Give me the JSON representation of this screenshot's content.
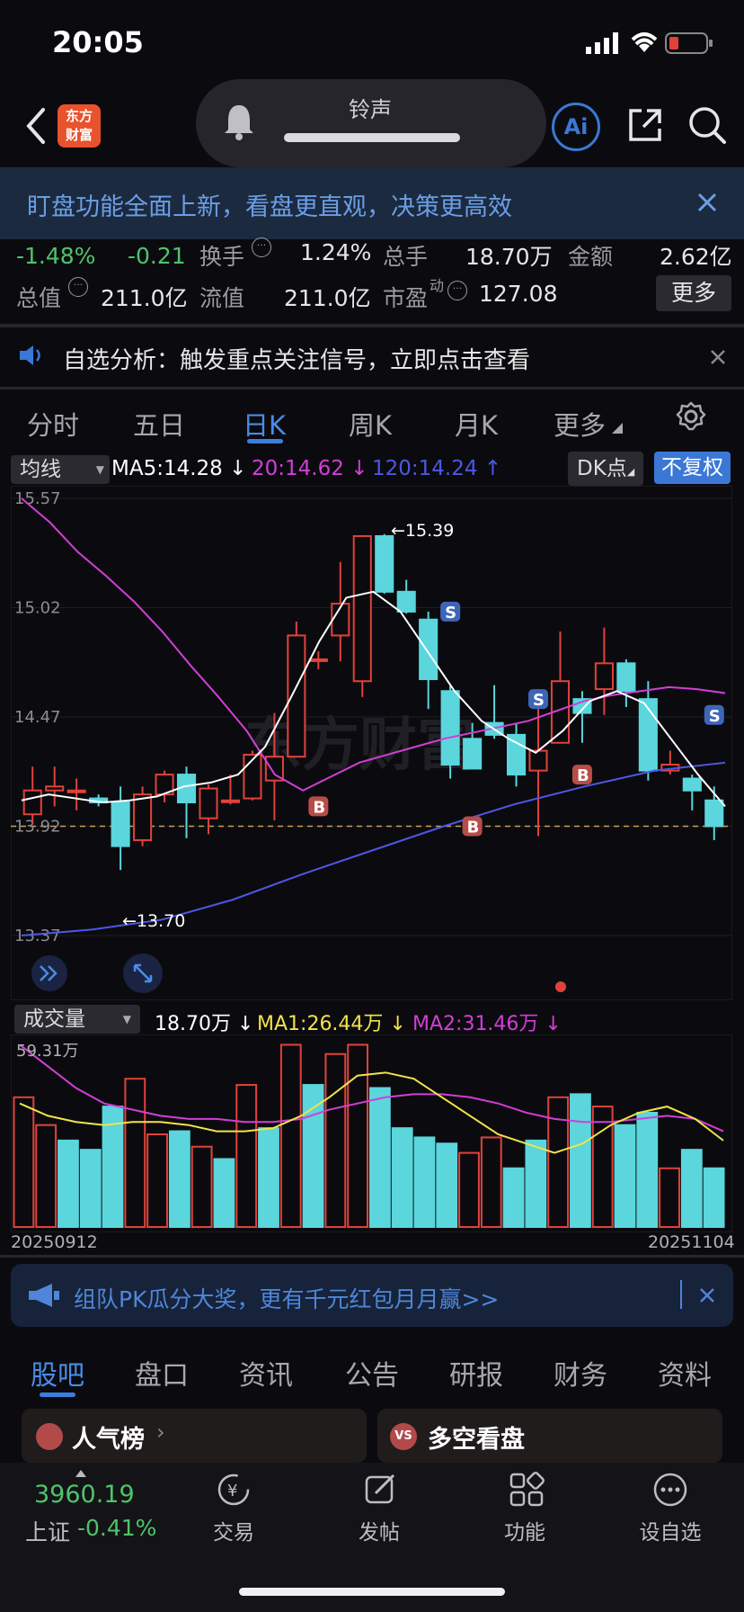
{
  "status": {
    "time": "20:05"
  },
  "header": {
    "logo": "东方\n财富",
    "logo_line1": "东方",
    "logo_line2": "财富",
    "pill_label": "铃声",
    "ai_label": "Ai"
  },
  "banner": {
    "text": "盯盘功能全面上新，看盘更直观，决策更高效"
  },
  "stats": {
    "change_pct": "-1.48%",
    "change_abs": "-0.21",
    "turnover_label": "换手",
    "turnover_value": "1.24%",
    "volume_label": "总手",
    "volume_value": "18.70万",
    "amount_label": "金额",
    "amount_value": "2.62亿",
    "mcap_label": "总值",
    "mcap_value": "211.0亿",
    "float_label": "流值",
    "float_value": "211.0亿",
    "pe_label": "市盈",
    "pe_sup": "动",
    "pe_value": "127.08",
    "more_button": "更多"
  },
  "notice": {
    "text": "自选分析：触发重点关注信号，立即点击查看"
  },
  "tabs": [
    {
      "label": "分时"
    },
    {
      "label": "五日"
    },
    {
      "label": "日K",
      "active": true
    },
    {
      "label": "周K"
    },
    {
      "label": "月K"
    },
    {
      "label": "更多"
    }
  ],
  "ma_bar": {
    "selector": "均线",
    "ma5": "MA5:14.28",
    "ma20": "20:14.62",
    "ma120": "120:14.24",
    "dk_button": "DK点",
    "fq_button": "不复权",
    "colors": {
      "ma5": "#ffffff",
      "ma20": "#d23ed6",
      "ma120": "#4c58e6",
      "up": "#e0423a",
      "down": "#5ad6dc"
    }
  },
  "chart_data": {
    "type": "candlestick",
    "y_ticks": [
      "15.57",
      "15.02",
      "14.47",
      "13.92",
      "13.37"
    ],
    "ylim": [
      13.37,
      15.57
    ],
    "price_line": 13.92,
    "annotations": {
      "high": "←15.39",
      "low": "←13.70"
    },
    "candles": [
      {
        "o": 13.98,
        "c": 14.1,
        "h": 14.22,
        "l": 13.93
      },
      {
        "o": 14.1,
        "c": 14.12,
        "h": 14.22,
        "l": 14.02
      },
      {
        "o": 14.1,
        "c": 14.1,
        "h": 14.16,
        "l": 14.0
      },
      {
        "o": 14.06,
        "c": 14.04,
        "h": 14.08,
        "l": 14.02
      },
      {
        "o": 14.04,
        "c": 13.82,
        "h": 14.12,
        "l": 13.7
      },
      {
        "o": 13.85,
        "c": 14.08,
        "h": 14.12,
        "l": 13.82
      },
      {
        "o": 14.08,
        "c": 14.18,
        "h": 14.2,
        "l": 14.04
      },
      {
        "o": 14.18,
        "c": 14.04,
        "h": 14.22,
        "l": 13.86
      },
      {
        "o": 13.96,
        "c": 14.11,
        "h": 14.13,
        "l": 13.88
      },
      {
        "o": 14.05,
        "c": 14.05,
        "h": 14.18,
        "l": 14.03
      },
      {
        "o": 14.06,
        "c": 14.28,
        "h": 14.3,
        "l": 14.05
      },
      {
        "o": 14.15,
        "c": 14.27,
        "h": 14.49,
        "l": 13.95
      },
      {
        "o": 14.27,
        "c": 14.88,
        "h": 14.95,
        "l": 14.27
      },
      {
        "o": 14.76,
        "c": 14.76,
        "h": 14.8,
        "l": 14.71
      },
      {
        "o": 14.88,
        "c": 15.04,
        "h": 15.25,
        "l": 14.75
      },
      {
        "o": 14.65,
        "c": 15.38,
        "h": 15.38,
        "l": 14.57
      },
      {
        "o": 15.38,
        "c": 15.1,
        "h": 15.39,
        "l": 15.09
      },
      {
        "o": 15.1,
        "c": 15.0,
        "h": 15.16,
        "l": 14.99
      },
      {
        "o": 14.96,
        "c": 14.66,
        "h": 15.0,
        "l": 14.51
      },
      {
        "o": 14.6,
        "c": 14.23,
        "h": 14.63,
        "l": 14.16
      },
      {
        "o": 14.36,
        "c": 14.21,
        "h": 14.44,
        "l": 14.22
      },
      {
        "o": 14.44,
        "c": 14.38,
        "h": 14.63,
        "l": 14.36
      },
      {
        "o": 14.38,
        "c": 14.18,
        "h": 14.44,
        "l": 14.12
      },
      {
        "o": 14.2,
        "c": 14.3,
        "h": 14.61,
        "l": 13.87
      },
      {
        "o": 14.34,
        "c": 14.65,
        "h": 14.9,
        "l": 14.35
      },
      {
        "o": 14.56,
        "c": 14.49,
        "h": 14.6,
        "l": 14.34
      },
      {
        "o": 14.61,
        "c": 14.74,
        "h": 14.92,
        "l": 14.48
      },
      {
        "o": 14.74,
        "c": 14.6,
        "h": 14.76,
        "l": 14.52
      },
      {
        "o": 14.56,
        "c": 14.2,
        "h": 14.65,
        "l": 14.15
      },
      {
        "o": 14.2,
        "c": 14.23,
        "h": 14.3,
        "l": 14.18
      },
      {
        "o": 14.16,
        "c": 14.1,
        "h": 14.18,
        "l": 14.0
      },
      {
        "o": 14.05,
        "c": 13.92,
        "h": 14.12,
        "l": 13.85
      }
    ],
    "ma5": [
      14.05,
      14.08,
      14.06,
      14.04,
      14.05,
      14.07,
      14.12,
      14.14,
      14.18,
      14.32,
      14.58,
      14.85,
      15.07,
      15.1,
      15.0,
      14.8,
      14.6,
      14.45,
      14.36,
      14.29,
      14.4,
      14.55,
      14.6,
      14.54,
      14.36,
      14.18,
      14.02
    ],
    "ma20": [
      15.57,
      15.45,
      15.3,
      15.18,
      15.05,
      14.9,
      14.73,
      14.57,
      14.4,
      14.18,
      14.1,
      14.17,
      14.24,
      14.28,
      14.32,
      14.36,
      14.39,
      14.42,
      14.45,
      14.5,
      14.55,
      14.58,
      14.6,
      14.62,
      14.61,
      14.59
    ],
    "ma120": [
      13.37,
      13.4,
      13.45,
      13.55,
      13.68,
      13.8,
      13.92,
      14.03,
      14.12,
      14.2,
      14.24
    ],
    "signals": [
      {
        "label": "B",
        "kind": "buy"
      },
      {
        "label": "B",
        "kind": "buy"
      },
      {
        "label": "B",
        "kind": "buy"
      },
      {
        "label": "S",
        "kind": "sell"
      },
      {
        "label": "S",
        "kind": "sell"
      },
      {
        "label": "S",
        "kind": "sell"
      }
    ]
  },
  "volume": {
    "selector": "成交量",
    "current": "18.70万",
    "ma1": "MA1:26.44万",
    "ma2": "MA2:31.46万",
    "max_label": "59.31万",
    "start_date": "20250912",
    "end_date": "20251104",
    "bars": [
      {
        "v": 42,
        "up": true
      },
      {
        "v": 33,
        "up": true
      },
      {
        "v": 28,
        "up": false
      },
      {
        "v": 25,
        "up": false
      },
      {
        "v": 39,
        "up": false
      },
      {
        "v": 48,
        "up": true
      },
      {
        "v": 30,
        "up": true
      },
      {
        "v": 31,
        "up": false
      },
      {
        "v": 26,
        "up": true
      },
      {
        "v": 22,
        "up": false
      },
      {
        "v": 46,
        "up": true
      },
      {
        "v": 32,
        "up": false
      },
      {
        "v": 59,
        "up": true
      },
      {
        "v": 46,
        "up": false
      },
      {
        "v": 56,
        "up": true
      },
      {
        "v": 59,
        "up": true
      },
      {
        "v": 45,
        "up": false
      },
      {
        "v": 32,
        "up": false
      },
      {
        "v": 29,
        "up": false
      },
      {
        "v": 27,
        "up": false
      },
      {
        "v": 24,
        "up": true
      },
      {
        "v": 29,
        "up": true
      },
      {
        "v": 19,
        "up": false
      },
      {
        "v": 28,
        "up": false
      },
      {
        "v": 42,
        "up": true
      },
      {
        "v": 43,
        "up": false
      },
      {
        "v": 39,
        "up": true
      },
      {
        "v": 33,
        "up": false
      },
      {
        "v": 37,
        "up": false
      },
      {
        "v": 19,
        "up": true
      },
      {
        "v": 25,
        "up": false
      },
      {
        "v": 19,
        "up": false
      }
    ],
    "ma1_line": [
      40,
      36,
      34,
      33,
      34,
      34,
      33,
      31,
      31,
      32,
      36,
      42,
      49,
      50,
      48,
      42,
      36,
      30,
      27,
      24,
      27,
      33,
      37,
      39,
      35,
      28
    ],
    "ma2_line": [
      59,
      52,
      45,
      40,
      38,
      36,
      35,
      35,
      34,
      34,
      35,
      38,
      40,
      42,
      43,
      43,
      42,
      40,
      37,
      35,
      34,
      34,
      35,
      36,
      35,
      31
    ]
  },
  "promo": {
    "text": "组队PK瓜分大奖，更有千元红包月月赢>>"
  },
  "bottom_tabs": [
    {
      "label": "股吧",
      "active": true
    },
    {
      "label": "盘口"
    },
    {
      "label": "资讯"
    },
    {
      "label": "公告"
    },
    {
      "label": "研报"
    },
    {
      "label": "财务"
    },
    {
      "label": "资料"
    }
  ],
  "cards": {
    "left": "人气榜",
    "right": "多空看盘"
  },
  "footer": {
    "index_value": "3960.19",
    "index_name": "上证",
    "index_change": "-0.41%",
    "items": [
      "交易",
      "发帖",
      "功能",
      "设自选"
    ]
  }
}
